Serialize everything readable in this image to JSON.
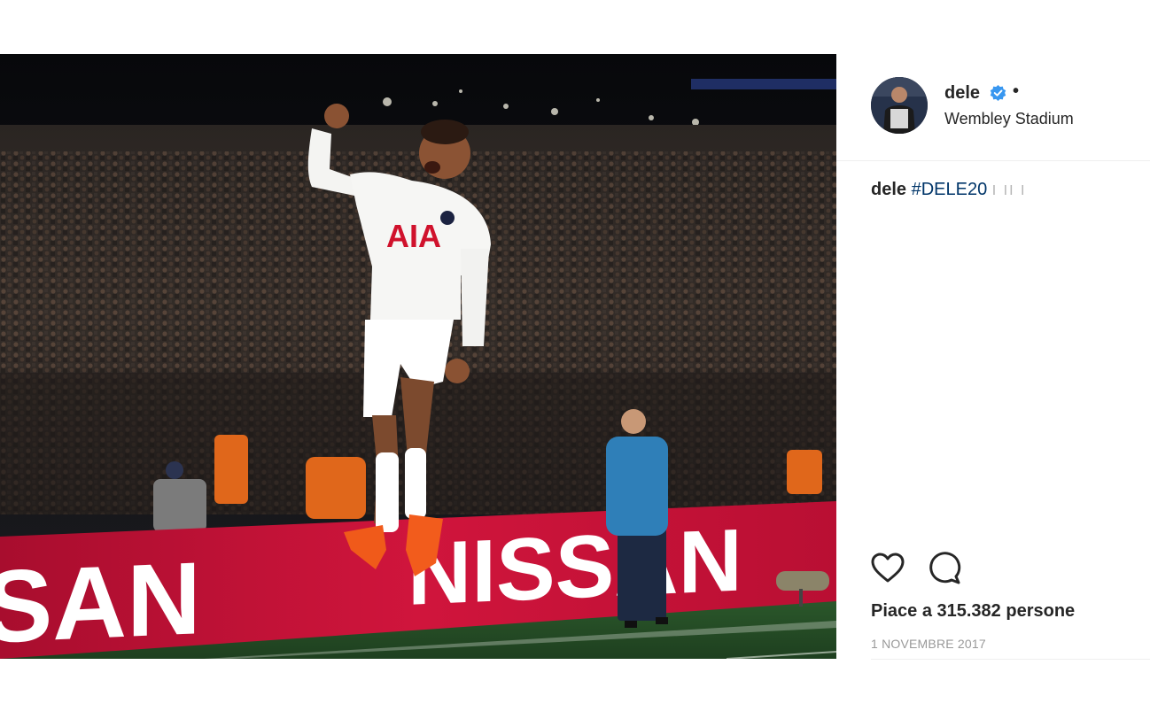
{
  "post": {
    "username": "dele",
    "location": "Wembley Stadium",
    "caption": {
      "user": "dele",
      "hashtag": "#DELE20",
      "marks": "I II I"
    },
    "likes_text": "Piace a 315.382 persone",
    "date": "1 NOVEMBRE 2017"
  },
  "photo": {
    "shirt_sponsor": "AIA",
    "board_text_left": "SAN",
    "board_text_right": "NISSAN"
  },
  "colors": {
    "hashtag": "#003569",
    "verified": "#3897f0",
    "board": "#c41236"
  },
  "icons": [
    "verified-badge-icon",
    "heart-icon",
    "comment-icon"
  ]
}
